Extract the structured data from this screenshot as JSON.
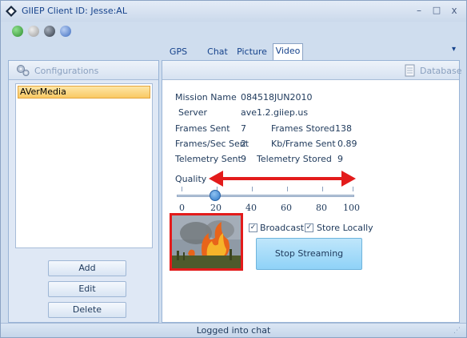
{
  "window": {
    "title": "GIIEP Client ID: Jesse:AL",
    "controls": {
      "minimize": "–",
      "maximize": "□",
      "close": "x"
    }
  },
  "toolbar": {
    "buttons": [
      {
        "icon": "connect-icon",
        "color": "#3aa83a"
      },
      {
        "icon": "gear-icon",
        "color": "#a6a6a6"
      },
      {
        "icon": "globe-icon",
        "color": "#404b5a"
      },
      {
        "icon": "help-icon",
        "color": "#4a78c8"
      }
    ]
  },
  "tabs": [
    {
      "label": "GPS Status",
      "active": false
    },
    {
      "label": "Chat",
      "active": false
    },
    {
      "label": "Picture",
      "active": false
    },
    {
      "label": "Video",
      "active": true
    }
  ],
  "tab_menu_glyph": "▾",
  "left_panel": {
    "title": "Configurations",
    "items": [
      "AVerMedia"
    ],
    "buttons": {
      "add": "Add",
      "edit": "Edit",
      "delete": "Delete"
    }
  },
  "right_panel": {
    "header_link": "Database",
    "mission_name_label": "Mission Name",
    "mission_name_value": "084518JUN2010",
    "server_label": "Server",
    "server_value": "ave1.2.giiep.us",
    "frames_sent_label": "Frames Sent",
    "frames_sent_value": "7",
    "frames_stored_label": "Frames Stored",
    "frames_stored_value": "138",
    "fps_label": "Frames/Sec Sent",
    "fps_value": "2",
    "kb_frame_label": "Kb/Frame Sent",
    "kb_frame_value": "0.89",
    "telemetry_sent_label": "Telemetry Sent",
    "telemetry_sent_value": "9",
    "telemetry_stored_label": "Telemetry Stored",
    "telemetry_stored_value": "9",
    "quality_label": "Quality",
    "quality_value": 20,
    "quality_ticks": [
      "0",
      "20",
      "40",
      "60",
      "80",
      "100"
    ],
    "broadcast_label": "Broadcast",
    "broadcast_checked": "✓",
    "store_locally_label": "Store Locally",
    "store_locally_checked": "✓",
    "stop_button": "Stop Streaming",
    "arrow_color": "#e31b1b",
    "highlight_color": "#e31b1b"
  },
  "status_bar": {
    "text": "Logged into chat",
    "grip": "⋰"
  }
}
